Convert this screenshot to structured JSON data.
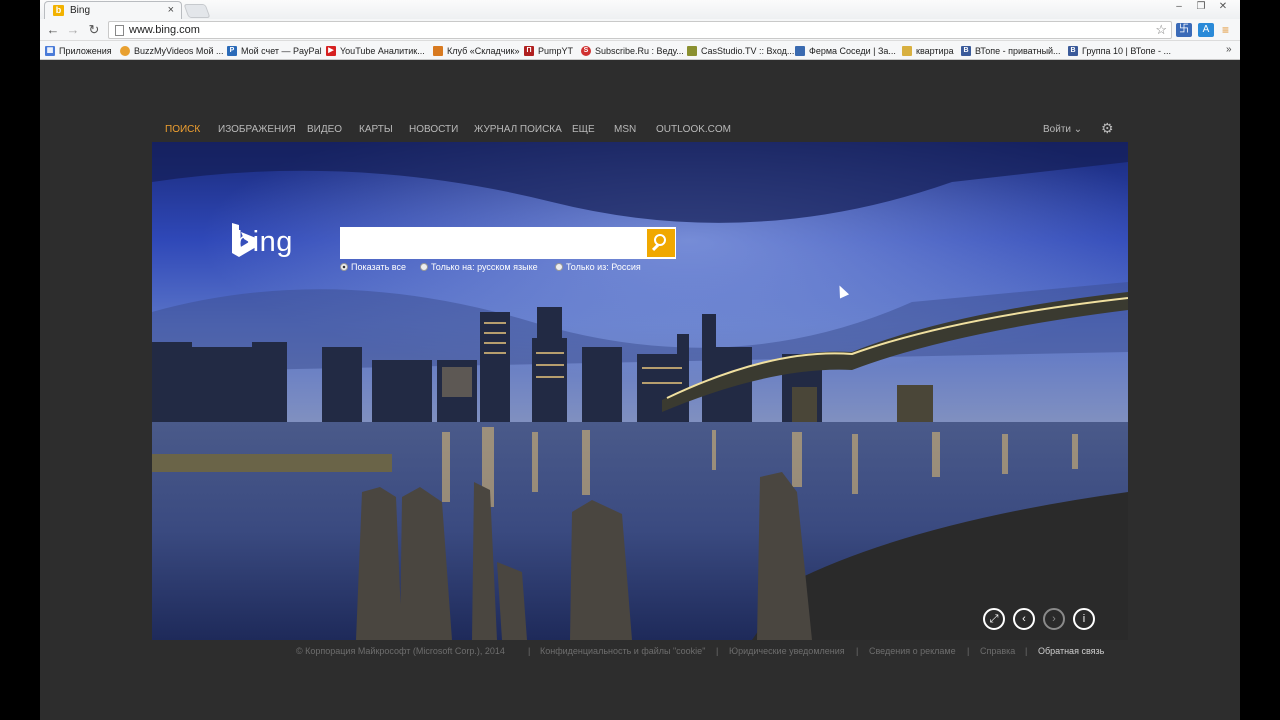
{
  "browser": {
    "tab_title": "Bing",
    "tab_close": "×",
    "url": "www.bing.com",
    "window_buttons": [
      "‒",
      "❐",
      "✕"
    ],
    "nav_icons": [
      "back-icon",
      "forward-icon",
      "reload-icon"
    ],
    "bookmarks": [
      {
        "label": "Приложения",
        "icon": "apps-icon",
        "color": "#4a7bd8"
      },
      {
        "label": "BuzzMyVideos Мой ...",
        "icon": "buzz-icon",
        "color": "#e8a030"
      },
      {
        "label": "Мой счет — PayPal",
        "icon": "paypal-icon",
        "color": "#2a6ab8"
      },
      {
        "label": "YouTube Аналитик...",
        "icon": "youtube-icon",
        "color": "#d62020"
      },
      {
        "label": "Клуб «Складчик»",
        "icon": "club-icon",
        "color": "#d87a20"
      },
      {
        "label": "PumpYT",
        "icon": "pump-icon",
        "color": "#b02020"
      },
      {
        "label": "Subscribe.Ru : Веду...",
        "icon": "subscribe-icon",
        "color": "#d03030"
      },
      {
        "label": "CasStudio.TV :: Вход...",
        "icon": "cas-icon",
        "color": "#8a9030"
      },
      {
        "label": "Ферма Соседи | За...",
        "icon": "farm-icon",
        "color": "#3a6ab0"
      },
      {
        "label": "квартира",
        "icon": "folder-icon",
        "color": "#d8b040"
      },
      {
        "label": "ВТопе - приватный...",
        "icon": "vtope-icon",
        "color": "#3a5a9a"
      },
      {
        "label": "Группа 10 | ВТопе - ...",
        "icon": "vtope-group-icon",
        "color": "#3a5a9a"
      }
    ],
    "bookmarks_more": "»"
  },
  "bing": {
    "nav": [
      "ПОИСК",
      "ИЗОБРАЖЕНИЯ",
      "ВИДЕО",
      "КАРТЫ",
      "НОВОСТИ",
      "ЖУРНАЛ ПОИСКА",
      "ЕЩЕ",
      "MSN",
      "OUTLOOK.COM"
    ],
    "login": "Войти ⌄",
    "logo_word": "bing",
    "search_value": "",
    "radios": [
      "Показать все",
      "Только на: русском языке",
      "Только из: Россия"
    ],
    "accent": "#f0a800",
    "hero_controls": [
      "expand-icon",
      "previous-icon",
      "next-icon",
      "info-icon"
    ],
    "footer": [
      "© Корпорация Майкрософт (Microsoft Corp.), 2014",
      "Конфиденциальность и файлы \"cookie\"",
      "Юридические уведомления",
      "Сведения о рекламе",
      "Справка",
      "Обратная связь"
    ]
  }
}
